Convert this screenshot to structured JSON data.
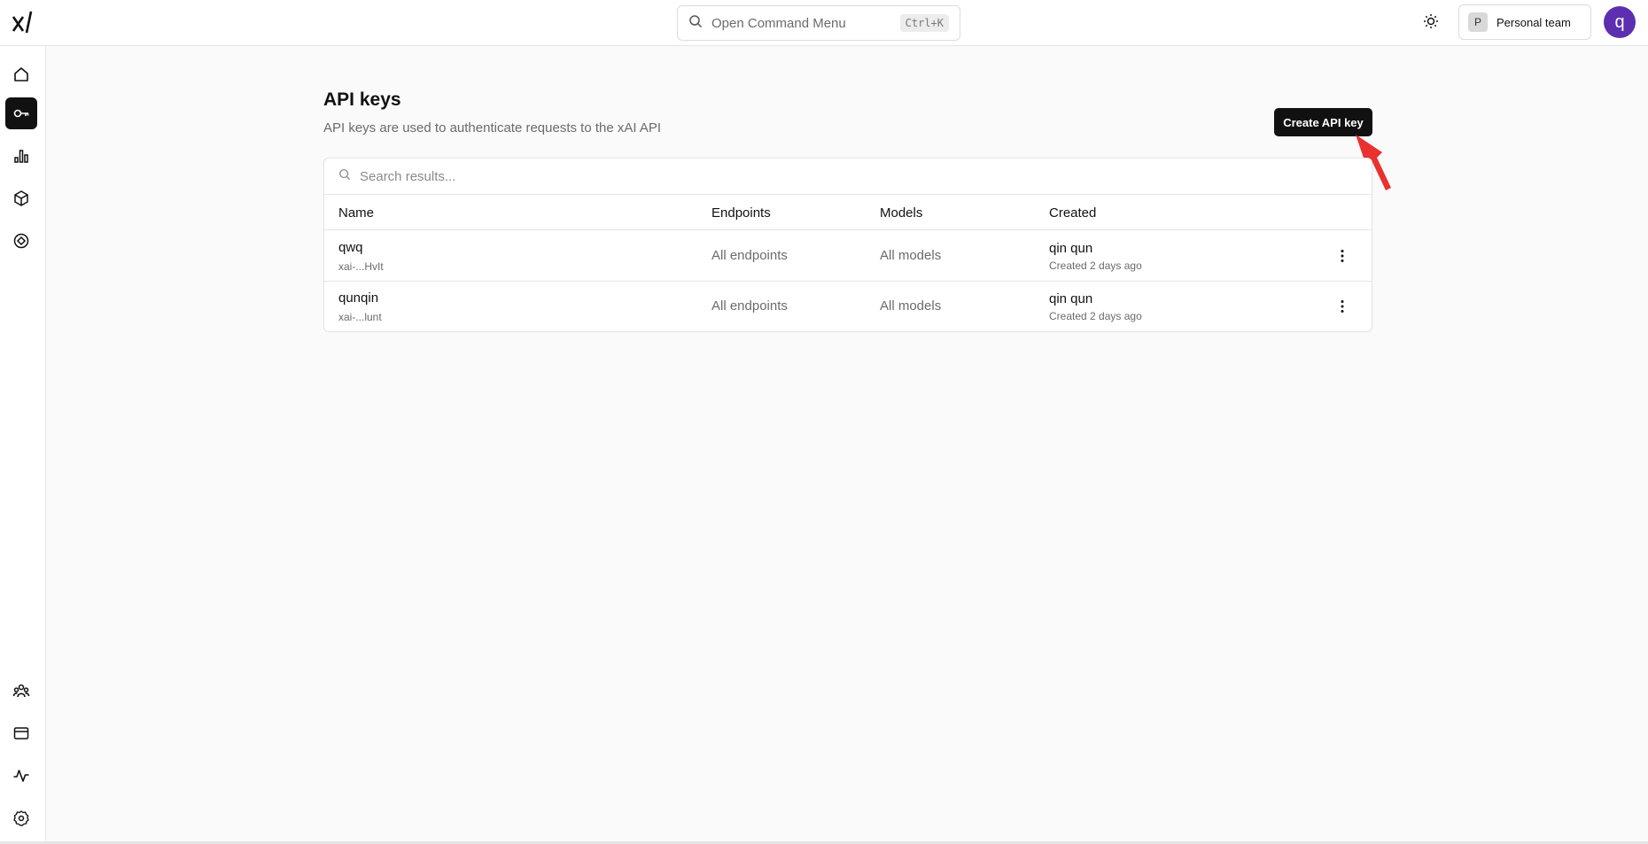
{
  "header": {
    "logo_icon": "xai-logo-icon",
    "command_menu": {
      "label": "Open Command Menu",
      "shortcut": "Ctrl+K"
    },
    "theme_icon": "sun-icon",
    "team": {
      "initial": "P",
      "name": "Personal team"
    },
    "user_initial": "q",
    "user_avatar_color": "#5b2fb0"
  },
  "sidebar": {
    "items": [
      {
        "icon": "home-icon",
        "active": false
      },
      {
        "icon": "key-icon",
        "active": true
      },
      {
        "icon": "bar-chart-icon",
        "active": false
      },
      {
        "icon": "cube-icon",
        "active": false
      },
      {
        "icon": "compass-icon",
        "active": false
      },
      {
        "icon": "team-icon",
        "active": false
      },
      {
        "icon": "billing-icon",
        "active": false
      },
      {
        "icon": "activity-icon",
        "active": false
      },
      {
        "icon": "settings-icon",
        "active": false
      }
    ]
  },
  "main": {
    "title": "API keys",
    "subtitle": "API keys are used to authenticate requests to the xAI API",
    "create_button": "Create API key",
    "search_placeholder": "Search results...",
    "columns": [
      "Name",
      "Endpoints",
      "Models",
      "Created"
    ],
    "rows": [
      {
        "name": "qwq",
        "key": "xai-...HvIt",
        "endpoints": "All endpoints",
        "models": "All models",
        "creator": "qin qun",
        "created": "Created 2 days ago"
      },
      {
        "name": "qunqin",
        "key": "xai-...lunt",
        "endpoints": "All endpoints",
        "models": "All models",
        "creator": "qin qun",
        "created": "Created 2 days ago"
      }
    ]
  },
  "annotation": {
    "arrow_color": "#e8322f"
  }
}
